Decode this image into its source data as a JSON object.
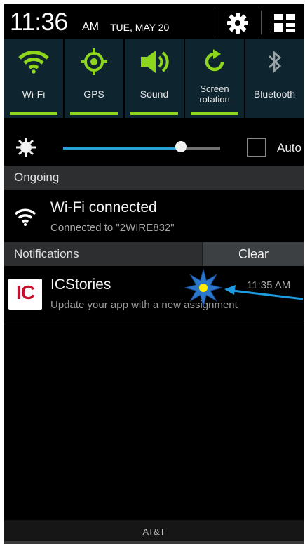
{
  "status_bar": {
    "time": "11:36",
    "ampm": "AM",
    "date": "TUE, MAY 20"
  },
  "quick_toggles": [
    {
      "label": "Wi-Fi",
      "icon": "wifi-icon",
      "on": true
    },
    {
      "label": "GPS",
      "icon": "gps-icon",
      "on": true
    },
    {
      "label": "Sound",
      "icon": "speaker-icon",
      "on": true
    },
    {
      "label": "Screen rotation",
      "line1": "Screen",
      "line2": "rotation",
      "icon": "rotate-icon",
      "on": true
    },
    {
      "label": "Bluetooth",
      "icon": "bluetooth-icon",
      "on": false
    }
  ],
  "brightness": {
    "level": 0.75,
    "auto_label": "Auto",
    "auto_checked": false
  },
  "ongoing": {
    "header": "Ongoing",
    "item": {
      "title": "Wi-Fi connected",
      "subtitle": "Connected to \"2WIRE832\"",
      "icon": "wifi-icon"
    }
  },
  "notifications": {
    "header": "Notifications",
    "clear_label": "Clear",
    "items": [
      {
        "app": "ICStories",
        "app_logo": "IC",
        "message": "Update your app with a new assignment",
        "time": "11:35 AM"
      }
    ]
  },
  "carrier": "AT&T",
  "colors": {
    "accent_green": "#8ed61e",
    "slider_blue": "#2a9fd6",
    "logo_red": "#c8102e",
    "annotation_blue": "#1e9be0",
    "star_yellow": "#ffee00"
  }
}
